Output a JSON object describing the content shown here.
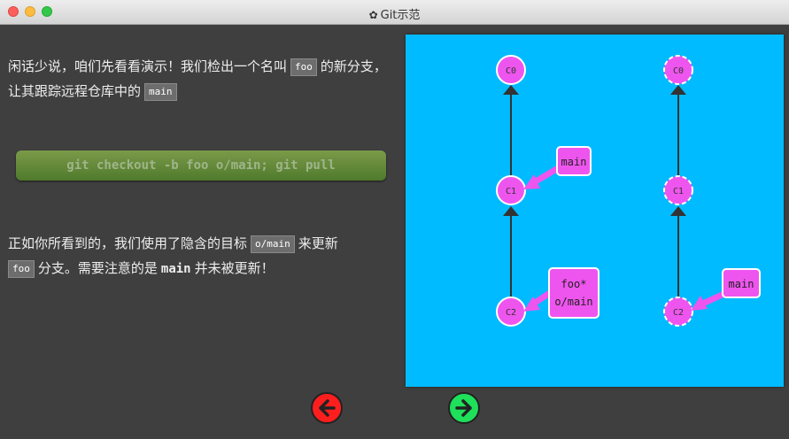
{
  "window": {
    "title": "Git示范",
    "gear_icon": "gear-icon"
  },
  "intro": {
    "t1": "闲话少说，咱们先看看演示！我们检出一个名叫",
    "code1": "foo",
    "t2": "的新分支，让其跟踪远程仓库中的",
    "code2": "main"
  },
  "command": "git checkout -b foo o/main; git pull",
  "outro": {
    "t1": "正如你所看到的，我们使用了隐含的目标",
    "code1": "o/main",
    "t2": "来更新",
    "code2": "foo",
    "t3": "分支。需要注意的是",
    "bold": "main",
    "t4": "并未被更新！"
  },
  "local": {
    "commits": [
      "C0",
      "C1",
      "C2"
    ],
    "branch_main": "main",
    "branch_foo": "foo*",
    "branch_origin": "o/main"
  },
  "remote": {
    "commits": [
      "C0",
      "C1",
      "C2"
    ],
    "branch_main": "main"
  },
  "colors": {
    "canvas": "#00bbff",
    "commit": "#ee55ee",
    "branch": "#ee55ee",
    "back": "#ff1e1e",
    "forward": "#1ee05a"
  },
  "nav": {
    "back_icon": "arrow-left-icon",
    "forward_icon": "arrow-right-icon"
  }
}
